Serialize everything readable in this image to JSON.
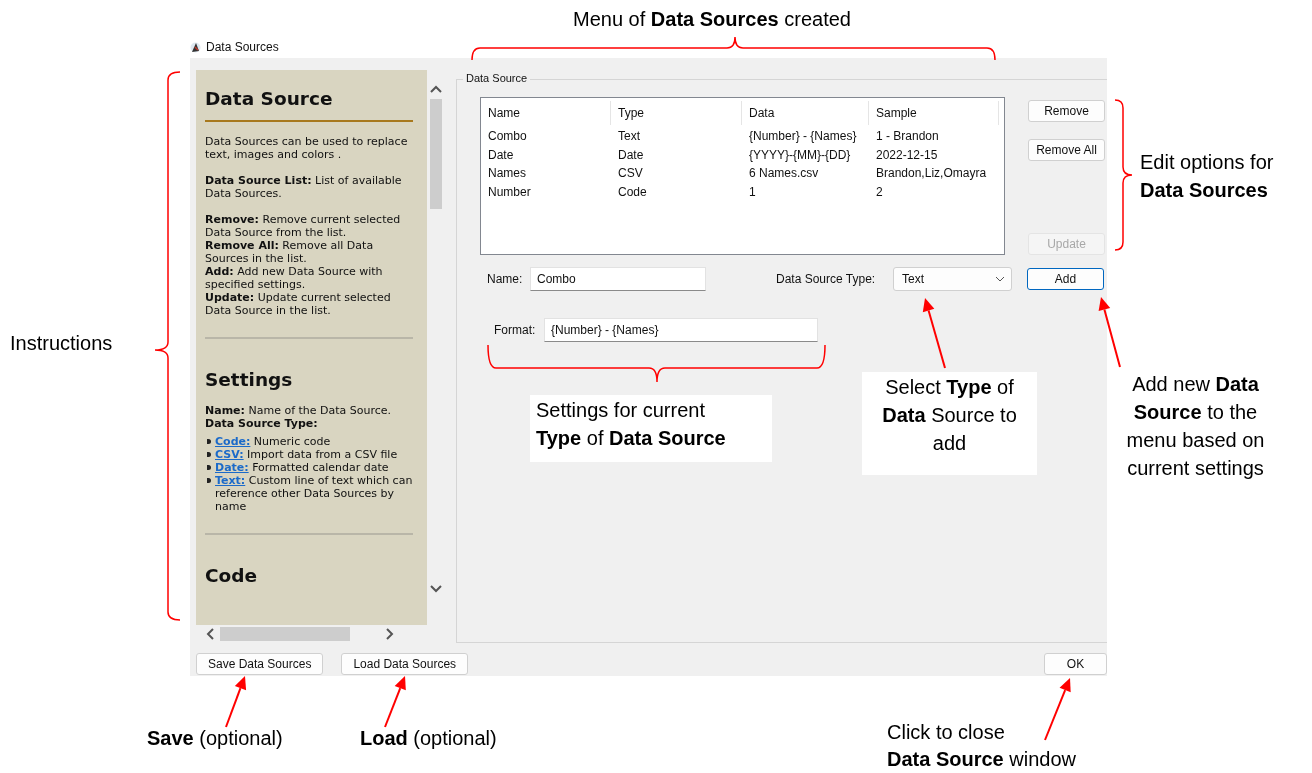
{
  "window": {
    "title": "Data Sources"
  },
  "help_panel": {
    "sections": [
      {
        "heading": "Data Source",
        "underlined": true,
        "paragraphs": [
          [
            "Data Sources can be used to replace text, images and colors ."
          ],
          [
            "**Data Source List:** List of available Data Sources."
          ],
          [
            "**Remove:** Remove current selected Data Source from the list.",
            "**Remove All:** Remove all Data Sources in the list.",
            "**Add:** Add new Data Source with specified settings.",
            "**Update:** Update current selected Data Source in the list."
          ]
        ]
      },
      {
        "heading": "Settings",
        "underlined": false,
        "paragraphs": [
          [
            "**Name:** Name of the Data Source.",
            "**Data Source Type:**"
          ]
        ],
        "bullets": [
          {
            "link": "Code:",
            "text": "Numeric code"
          },
          {
            "link": "CSV:",
            "text": "Import data from a CSV file"
          },
          {
            "link": "Date:",
            "text": "Formatted calendar date"
          },
          {
            "link": "Text:",
            "text": "Custom line of text which can reference other Data Sources by name"
          }
        ]
      },
      {
        "heading": "Code",
        "underlined": false
      }
    ]
  },
  "data_source_group": {
    "legend": "Data Source",
    "table": {
      "columns": [
        "Name",
        "Type",
        "Data",
        "Sample"
      ],
      "rows": [
        [
          "Combo",
          "Text",
          "{Number} - {Names}",
          "1 - Brandon"
        ],
        [
          "Date",
          "Date",
          "{YYYY}-{MM}-{DD}",
          "2022-12-15"
        ],
        [
          "Names",
          "CSV",
          "6 Names.csv",
          "Brandon,Liz,Omayra"
        ],
        [
          "Number",
          "Code",
          "1",
          "2"
        ]
      ]
    },
    "side_buttons": [
      {
        "label": "Remove",
        "disabled": false,
        "focused": false
      },
      {
        "label": "Remove All",
        "disabled": false,
        "focused": false
      },
      {
        "label": "Update",
        "disabled": true,
        "focused": false
      },
      {
        "label": "Add",
        "disabled": false,
        "focused": true
      }
    ],
    "name_label": "Name:",
    "name_value": "Combo",
    "type_label": "Data Source Type:",
    "type_value": "Text",
    "format_label": "Format:",
    "format_value": "{Number} - {Names}"
  },
  "bottom_buttons": {
    "save": "Save Data Sources",
    "load": "Load Data Sources",
    "ok": "OK"
  },
  "annotations": [
    {
      "kind": "brace",
      "lines": [
        "Menu of **Data Sources** created"
      ]
    },
    {
      "kind": "brace",
      "lines": [
        "Edit options for",
        "**Data Sources**"
      ]
    },
    {
      "kind": "brace",
      "lines": [
        "Instructions"
      ]
    },
    {
      "kind": "brace",
      "lines": [
        "Settings for current",
        "**Type** of **Data Source**"
      ]
    },
    {
      "kind": "arrow",
      "lines": [
        "Select **Type** of",
        "**Data** Source to",
        "add"
      ]
    },
    {
      "kind": "arrow",
      "lines": [
        "Add new **Data**",
        "**Source** to the",
        "menu based on",
        "current settings"
      ]
    },
    {
      "kind": "arrow",
      "lines": [
        "**Save** (optional)"
      ]
    },
    {
      "kind": "arrow",
      "lines": [
        "**Load** (optional)"
      ]
    },
    {
      "kind": "arrow",
      "lines": [
        "Click to close",
        "**Data Source** window"
      ]
    }
  ]
}
